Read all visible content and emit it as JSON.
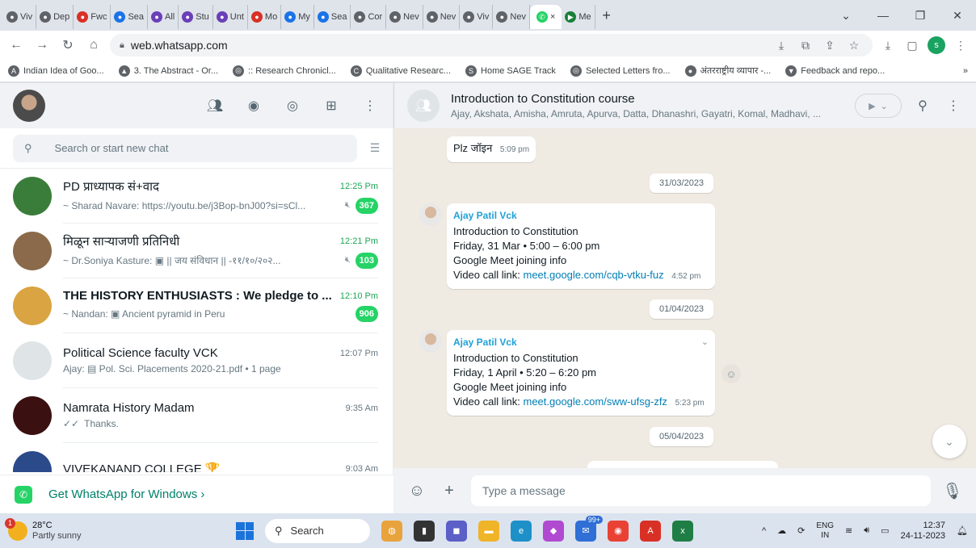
{
  "browser": {
    "tabs": [
      {
        "label": "Viv",
        "icon": "chrome-icon",
        "color": "#5f6368"
      },
      {
        "label": "Dep",
        "icon": "chrome-icon",
        "color": "#5f6368"
      },
      {
        "label": "Fwc",
        "icon": "gmail-icon",
        "color": "#d93025"
      },
      {
        "label": "Sea",
        "icon": "drive-icon",
        "color": "#1a73e8"
      },
      {
        "label": "All",
        "icon": "sheets-icon",
        "color": "#6a3fb8"
      },
      {
        "label": "Stu",
        "icon": "sheets-icon",
        "color": "#6a3fb8"
      },
      {
        "label": "Unt",
        "icon": "sheets-icon",
        "color": "#6a3fb8"
      },
      {
        "label": "Mo",
        "icon": "gmail-icon",
        "color": "#d93025"
      },
      {
        "label": "My",
        "icon": "drive-icon",
        "color": "#1a73e8"
      },
      {
        "label": "Sea",
        "icon": "drive-icon",
        "color": "#1a73e8"
      },
      {
        "label": "Cor",
        "icon": "chrome-icon",
        "color": "#5f6368"
      },
      {
        "label": "Nev",
        "icon": "chrome-icon",
        "color": "#5f6368"
      },
      {
        "label": "Nev",
        "icon": "chrome-icon",
        "color": "#5f6368"
      },
      {
        "label": "Viv",
        "icon": "chrome-icon",
        "color": "#5f6368"
      },
      {
        "label": "Nev",
        "icon": "chrome-icon",
        "color": "#5f6368"
      }
    ],
    "active_tab_close": "×",
    "last_tab_label": "Me",
    "new_tab": "+",
    "url": "web.whatsapp.com",
    "bookmarks": [
      {
        "label": "Indian Idea of Goo...",
        "icon": "A"
      },
      {
        "label": "3. The Abstract - Or...",
        "icon": "▲"
      },
      {
        "label": ":: Research Chronicl...",
        "icon": "◎"
      },
      {
        "label": "Qualitative Researc...",
        "icon": "C"
      },
      {
        "label": "Home SAGE Track",
        "icon": "S"
      },
      {
        "label": "Selected Letters fro...",
        "icon": "◎"
      },
      {
        "label": "अंतरराष्ट्रीय व्यापार -...",
        "icon": "●"
      },
      {
        "label": "Feedback and repo...",
        "icon": "▼"
      }
    ],
    "bookmarks_more": "»"
  },
  "sidebar": {
    "search_placeholder": "Search or start new chat",
    "chats": [
      {
        "name": "PD प्राध्यापक सं+वाद",
        "time": "12:25 Pm",
        "preview": "~ Sharad Navare: https://youtu.be/j3Bop-bnJ00?si=sCl...",
        "muted": true,
        "unread": "367",
        "bold": false,
        "avatar_color": "#3a7d3a"
      },
      {
        "name": "मिळून साऱ्याजणी प्रतिनिधी",
        "time": "12:21 Pm",
        "preview": "~ Dr.Soniya Kasture: ▣ || जय संविधान ||       -११/१०/२०२...",
        "muted": true,
        "unread": "103",
        "bold": false,
        "avatar_color": "#8a6a4a"
      },
      {
        "name": "THE HISTORY ENTHUSIASTS : We pledge to ...",
        "time": "12:10 Pm",
        "preview": "~ Nandan: ▣ Ancient pyramid in Peru",
        "muted": false,
        "unread": "906",
        "bold": true,
        "avatar_color": "#d9a441"
      },
      {
        "name": "Political Science faculty VCK",
        "time": "12:07 Pm",
        "preview": "Ajay: ▤ Pol. Sci. Placements 2020-21.pdf • 1 page",
        "muted": false,
        "unread": "",
        "bold": false,
        "avatar_color": "#dfe5e7"
      },
      {
        "name": "Namrata History Madam",
        "time": "9:35 Am",
        "preview": "Thanks.",
        "muted": false,
        "unread": "",
        "bold": false,
        "avatar_color": "#3b1010"
      },
      {
        "name": "VIVEKANAND COLLEGE 🏆",
        "time": "9:03 Am",
        "preview": "",
        "muted": false,
        "unread": "",
        "bold": false,
        "avatar_color": "#2b4a8a"
      }
    ],
    "get_app": "Get WhatsApp for Windows",
    "get_app_arrow": "›"
  },
  "conversation": {
    "title": "Introduction to Constitution course",
    "members": "Ajay, Akshata, Amisha, Amruta, Apurva, Datta, Dhanashri, Gayatri, Komal, Madhavi, ...",
    "message1": {
      "text": "Plz जॉइन",
      "time": "5:09 pm"
    },
    "date1": "31/03/2023",
    "message2": {
      "sender": "Ajay Patil Vck",
      "line1": "Introduction to Constitution",
      "line2": "Friday, 31 Mar  •  5:00 – 6:00 pm",
      "line3": "Google Meet joining info",
      "line4_prefix": "Video call link: ",
      "link": "meet.google.com/cqb-vtku-fuz",
      "time": "4:52 pm"
    },
    "date2": "01/04/2023",
    "message3": {
      "sender": "Ajay Patil Vck",
      "line1": "Introduction to Constitution",
      "line2": "Friday, 1 April  •  5:20 – 6:20 pm",
      "line3": "Google Meet joining info",
      "line4_prefix": "Video call link: ",
      "link": "meet.google.com/sww-ufsg-zfz",
      "time": "5:23 pm"
    },
    "date3": "05/04/2023",
    "composer_placeholder": "Type a message"
  },
  "taskbar": {
    "temperature": "28°C",
    "weather": "Partly sunny",
    "weather_badge": "1",
    "search_label": "Search",
    "chrome_badge": "99+",
    "language_line1": "ENG",
    "language_line2": "IN",
    "time": "12:37",
    "date": "24-11-2023"
  }
}
